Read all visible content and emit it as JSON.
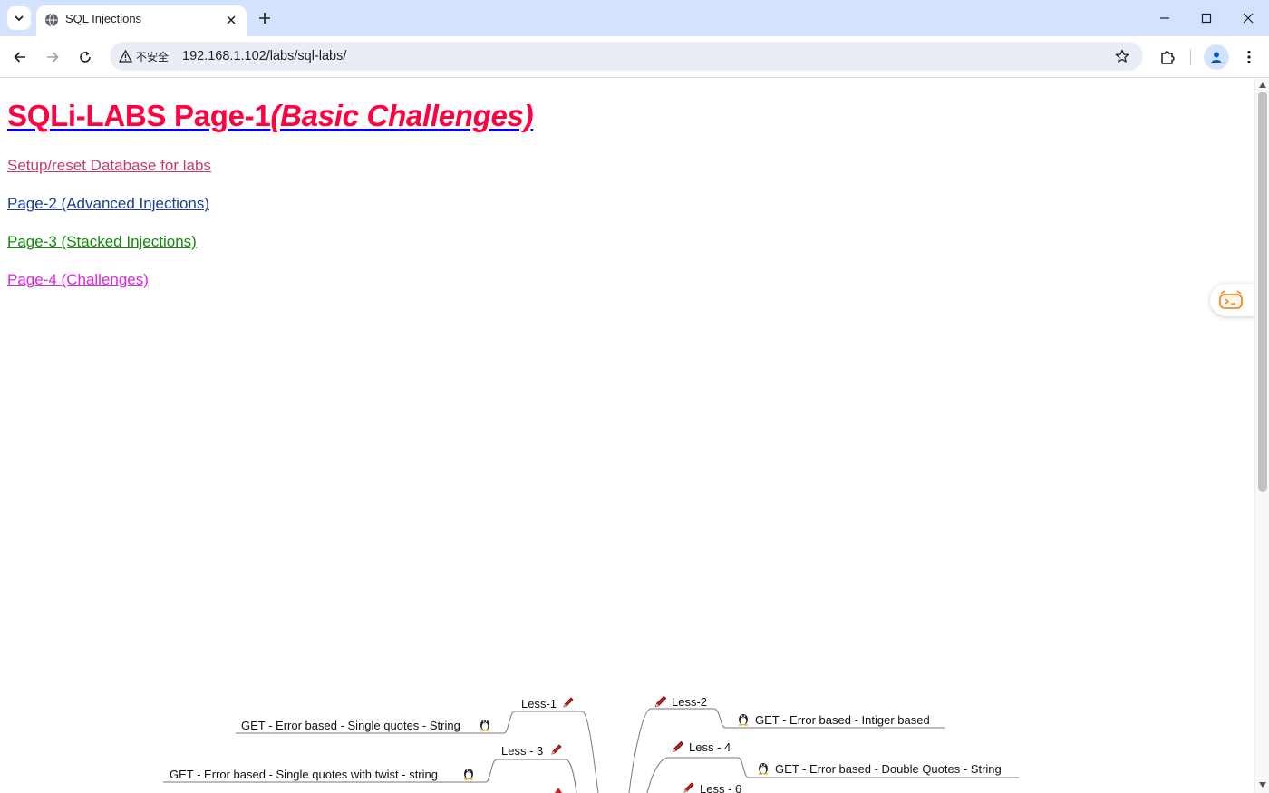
{
  "browser": {
    "tab_title": "SQL Injections",
    "security_label": "不安全",
    "url": "192.168.1.102/labs/sql-labs/"
  },
  "page": {
    "title_main": "SQLi-LABS Page-1",
    "title_sub": "(Basic Challenges)",
    "links": {
      "setup": "Setup/reset Database for labs",
      "page2": "Page-2 (Advanced Injections)",
      "page3": "Page-3 (Stacked Injections)",
      "page4": "Page-4 (Challenges)"
    },
    "colors": {
      "title": "#ff0040",
      "setup": "#c43c6c",
      "page2": "#1c3c99",
      "page3": "#138a0c",
      "page4": "#e621e6"
    }
  },
  "mindmap": {
    "less1": "Less-1",
    "less1_desc": "GET - Error based - Single quotes - String",
    "less2": "Less-2",
    "less2_desc": "GET - Error based - Intiger based",
    "less3": "Less - 3",
    "less3_desc": "GET - Error based - Single quotes with twist - string",
    "less4": "Less - 4",
    "less4_desc": "GET - Error based - Double Quotes - String",
    "less6": "Less - 6"
  }
}
